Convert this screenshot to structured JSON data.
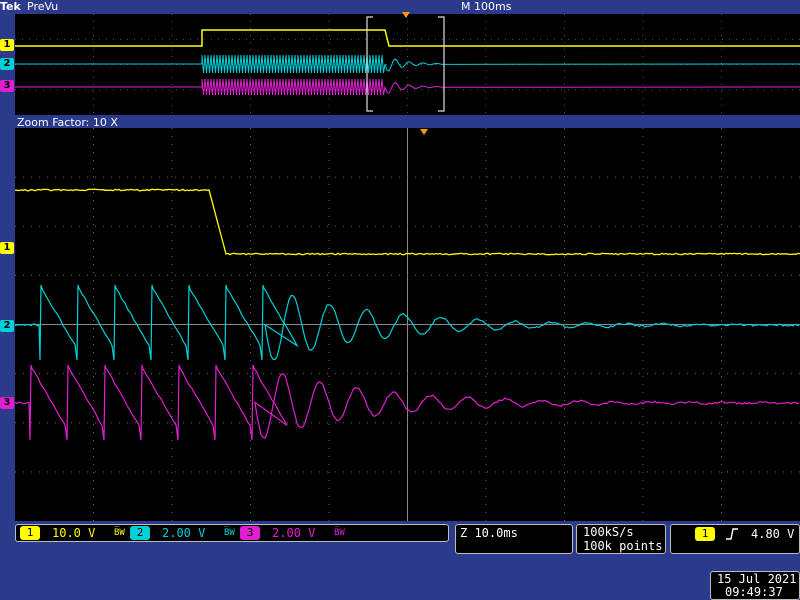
{
  "header": {
    "brand": "Tek",
    "mode": "PreVu",
    "timebase": "M 100ms"
  },
  "zoom": {
    "label": "Zoom Factor: 10 X"
  },
  "channels": [
    {
      "num": "1",
      "scale": "10.0 V",
      "color": "#ffff00"
    },
    {
      "num": "2",
      "scale": "2.00 V",
      "color": "#00d0d8"
    },
    {
      "num": "3",
      "scale": "2.00 V",
      "color": "#e020d0"
    }
  ],
  "bw_symbol": "B̅W",
  "horizontal": {
    "zoom_scale": "Z 10.0ms",
    "sample_rate": "100kS/s",
    "record_length": "100k points"
  },
  "trigger": {
    "channel": "1",
    "slope_icon": "rising-edge-icon",
    "level": "4.80 V"
  },
  "datetime": {
    "date": "15 Jul   2021",
    "time": "09:49:37"
  }
}
